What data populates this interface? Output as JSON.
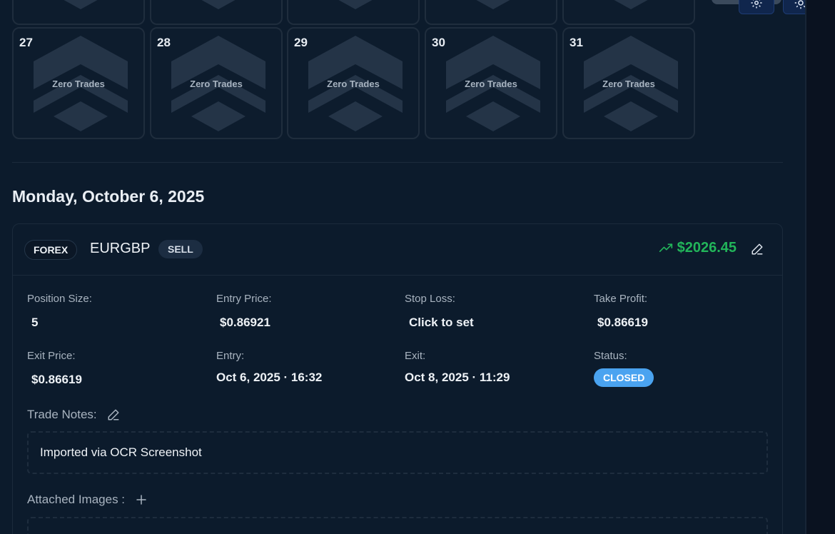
{
  "calendar": {
    "partial_row_count": 5,
    "tiles": [
      {
        "day": "27",
        "label": "Zero Trades"
      },
      {
        "day": "28",
        "label": "Zero Trades"
      },
      {
        "day": "29",
        "label": "Zero Trades"
      },
      {
        "day": "30",
        "label": "Zero Trades"
      },
      {
        "day": "31",
        "label": "Zero Trades"
      }
    ]
  },
  "top_icons": [
    "settings-icon",
    "sun-icon"
  ],
  "date_heading": "Monday, October 6, 2025",
  "trade": {
    "market": "FOREX",
    "symbol": "EURGBP",
    "side": "SELL",
    "pnl": "$2026.45",
    "pnl_color": "#22b55a",
    "fields": {
      "position_size": {
        "label": "Position Size:",
        "value": "5"
      },
      "entry_price": {
        "label": "Entry Price:",
        "value": "$0.86921"
      },
      "stop_loss": {
        "label": "Stop Loss:",
        "value": "Click to set"
      },
      "take_profit": {
        "label": "Take Profit:",
        "value": "$0.86619"
      },
      "exit_price": {
        "label": "Exit Price:",
        "value": "$0.86619"
      },
      "entry": {
        "label": "Entry:",
        "value": "Oct 6, 2025 · 16:32"
      },
      "exit": {
        "label": "Exit:",
        "value": "Oct 8, 2025 · 11:29"
      },
      "status": {
        "label": "Status:",
        "value": "CLOSED",
        "color": "#4aa3f0"
      }
    },
    "notes_label": "Trade Notes:",
    "notes_text": "Imported via OCR Screenshot",
    "images_label": "Attached Images :"
  }
}
